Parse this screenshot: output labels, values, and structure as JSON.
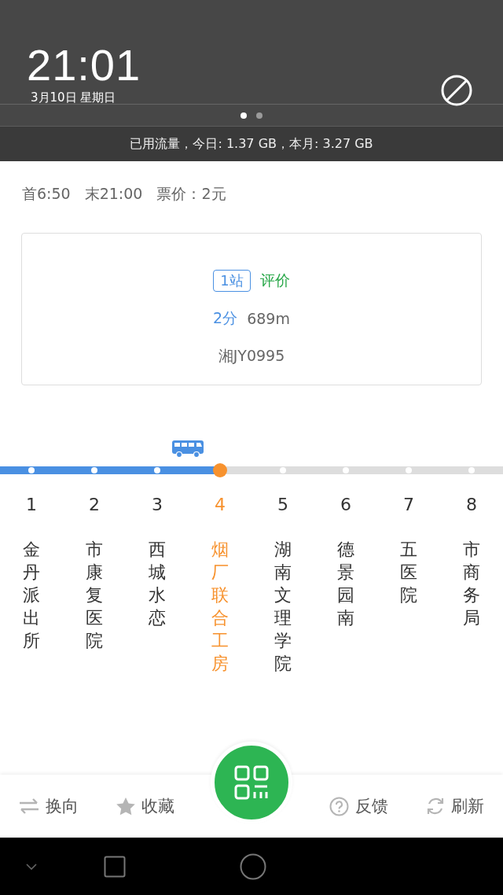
{
  "status_shade": {
    "time": "21:01",
    "date": "3月10日 星期日",
    "pages": [
      {
        "selected": true
      },
      {
        "selected": false
      }
    ],
    "data_usage": "已用流量，今日: 1.37 GB，本月: 3.27 GB"
  },
  "schedule": [
    "首6:50",
    "末21:00",
    "票价：2元"
  ],
  "arrival_card": {
    "stops_away": "1站",
    "rate_link": "评价",
    "eta": "2分",
    "distance": "689m",
    "plate": "湘JY0995"
  },
  "stops": [
    {
      "number": "1",
      "name": "金丹派出所",
      "selected": false
    },
    {
      "number": "2",
      "name": "市康复医院",
      "selected": false
    },
    {
      "number": "3",
      "name": "西城水恋",
      "selected": false
    },
    {
      "number": "4",
      "name": "烟厂联合工房",
      "selected": true
    },
    {
      "number": "5",
      "name": "湖南文理学院",
      "selected": false
    },
    {
      "number": "6",
      "name": "德景园南",
      "selected": false
    },
    {
      "number": "7",
      "name": "五医院",
      "selected": false
    },
    {
      "number": "8",
      "name": "市商务局",
      "selected": false
    }
  ],
  "toolbar": [
    {
      "kind": "swap",
      "label": "换向"
    },
    {
      "kind": "star",
      "label": "收藏"
    },
    {
      "kind": "scan"
    },
    {
      "kind": "question",
      "label": "反馈"
    },
    {
      "kind": "refresh",
      "label": "刷新"
    }
  ]
}
